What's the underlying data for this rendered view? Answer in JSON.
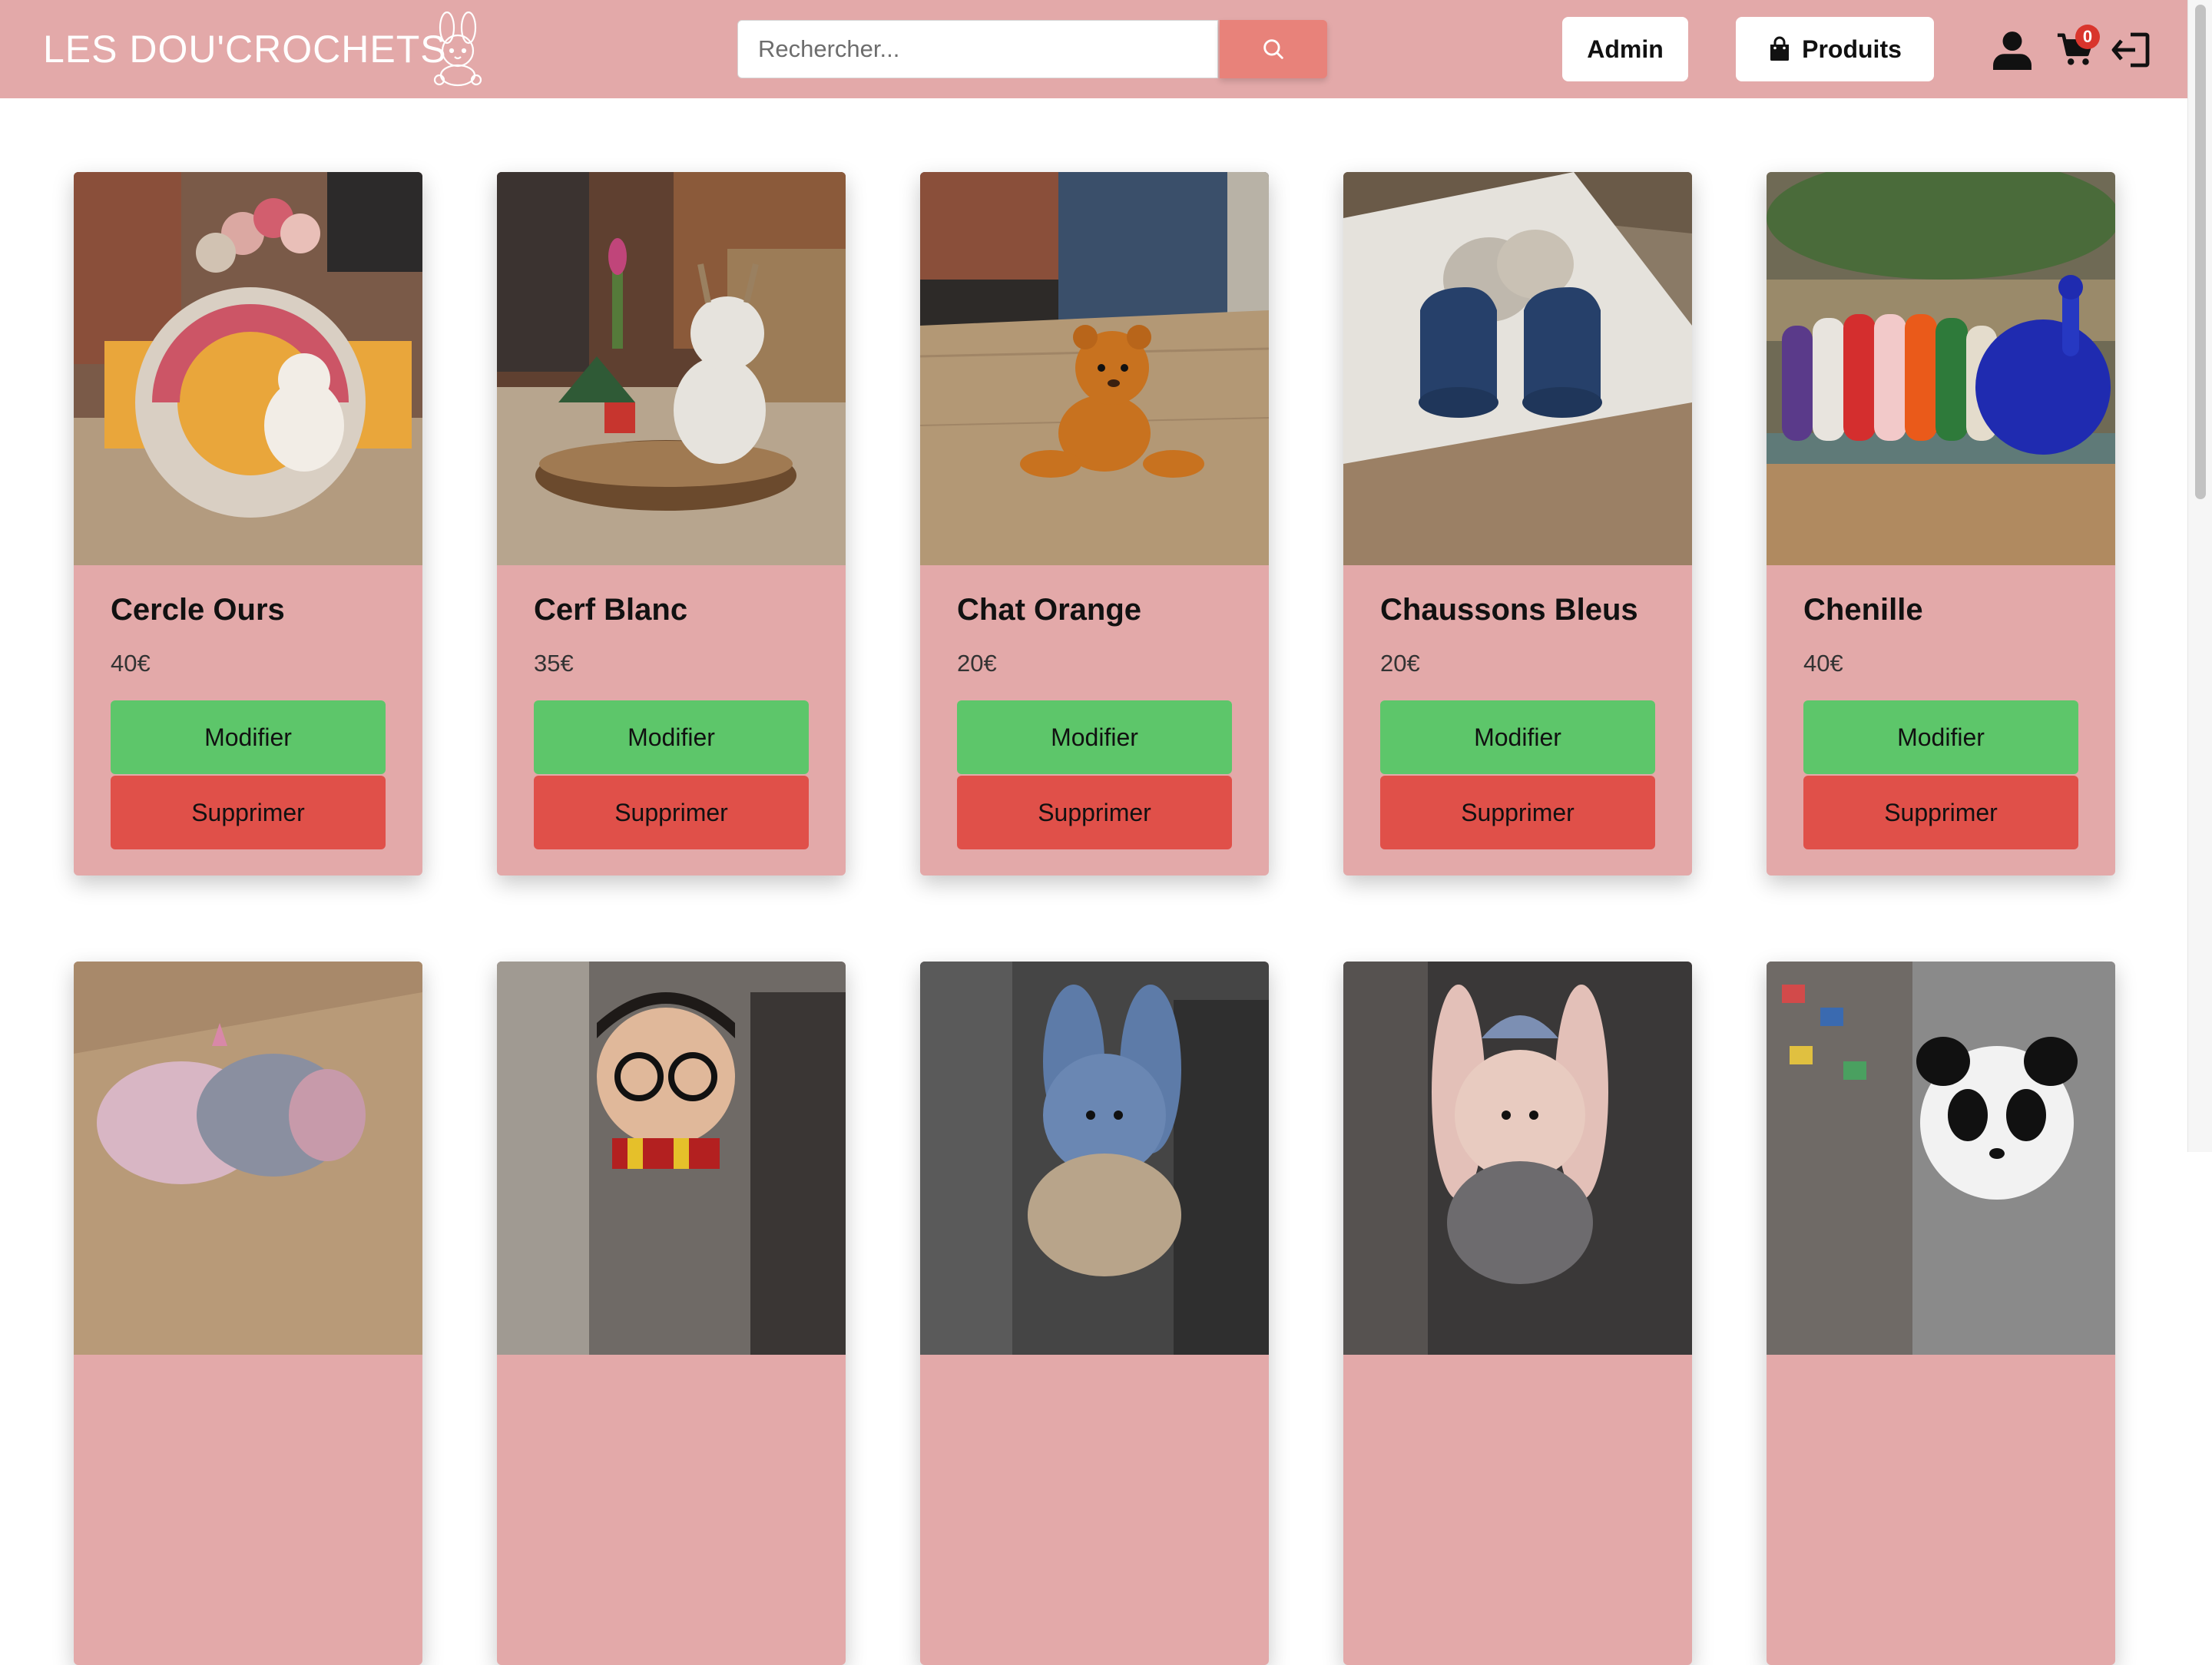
{
  "header": {
    "logo_text": "LES DOU'CROCHETS",
    "search_placeholder": "Rechercher...",
    "admin_label": "Admin",
    "produits_label": "Produits",
    "cart_count": "0",
    "background_color": "#e3a9a9"
  },
  "icons": {
    "search": "search-icon",
    "bag": "shopping-bag-icon",
    "user": "user-icon",
    "cart": "cart-icon",
    "logout": "logout-icon"
  },
  "products": [
    {
      "name": "Cercle Ours",
      "price": "40€",
      "edit_label": "Modifier",
      "delete_label": "Supprimer"
    },
    {
      "name": "Cerf Blanc",
      "price": "35€",
      "edit_label": "Modifier",
      "delete_label": "Supprimer"
    },
    {
      "name": "Chat Orange",
      "price": "20€",
      "edit_label": "Modifier",
      "delete_label": "Supprimer"
    },
    {
      "name": "Chaussons Bleus",
      "price": "20€",
      "edit_label": "Modifier",
      "delete_label": "Supprimer"
    },
    {
      "name": "Chenille",
      "price": "40€",
      "edit_label": "Modifier",
      "delete_label": "Supprimer"
    }
  ],
  "colors": {
    "accent": "#e3a9a9",
    "search_button": "#e8827a",
    "modify_button": "#5dc66a",
    "delete_button": "#e05049",
    "badge": "#d9352c"
  }
}
